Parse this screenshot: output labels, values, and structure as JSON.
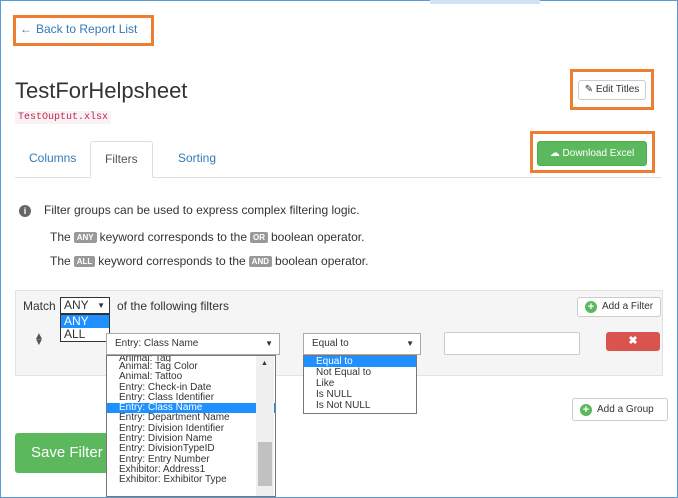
{
  "back_link": {
    "arrow": "←",
    "label": "Back to Report List"
  },
  "report": {
    "title": "TestForHelpsheet",
    "output_file": "TestOuptut.xlsx"
  },
  "buttons": {
    "edit_titles": "Edit Titles",
    "download_excel": "Download Excel",
    "add_filter": "Add a Filter",
    "add_group": "Add a Group",
    "save_filter": "Save Filter",
    "delete": "✖"
  },
  "tabs": [
    {
      "label": "Columns"
    },
    {
      "label": "Filters",
      "active": true
    },
    {
      "label": "Sorting"
    }
  ],
  "info": {
    "line1": "Filter groups can be used to express complex filtering logic.",
    "line2_pre": "The",
    "line2_kw": "ANY",
    "line2_mid": "keyword corresponds to the",
    "line2_op": "OR",
    "line2_post": "boolean operator.",
    "line3_pre": "The",
    "line3_kw": "ALL",
    "line3_mid": "keyword corresponds to the",
    "line3_op": "AND",
    "line3_post": "boolean operator."
  },
  "match": {
    "label": "Match",
    "selected": "ANY",
    "after": "of the following filters",
    "options": [
      "ANY",
      "ALL"
    ]
  },
  "filter": {
    "field_selected": "Entry: Class Name",
    "operator_selected": "Equal to",
    "value": "",
    "field_options": [
      "Animal: Tag",
      "Animal: Tag Color",
      "Animal: Tattoo",
      "Entry: Check-in Date",
      "Entry: Class Identifier",
      "Entry: Class Name",
      "Entry: Department Name",
      "Entry: Division Identifier",
      "Entry: Division Name",
      "Entry: DivisionTypeID",
      "Entry: Entry Number",
      "Exhibitor: Address1",
      "Exhibitor: Exhibitor Type"
    ],
    "operator_options": [
      "Equal to",
      "Not Equal to",
      "Like",
      "Is NULL",
      "Is Not NULL"
    ]
  },
  "colors": {
    "accent": "#337ab7",
    "success": "#5cb85c",
    "danger": "#d9534f",
    "highlight": "#ed7d31"
  }
}
